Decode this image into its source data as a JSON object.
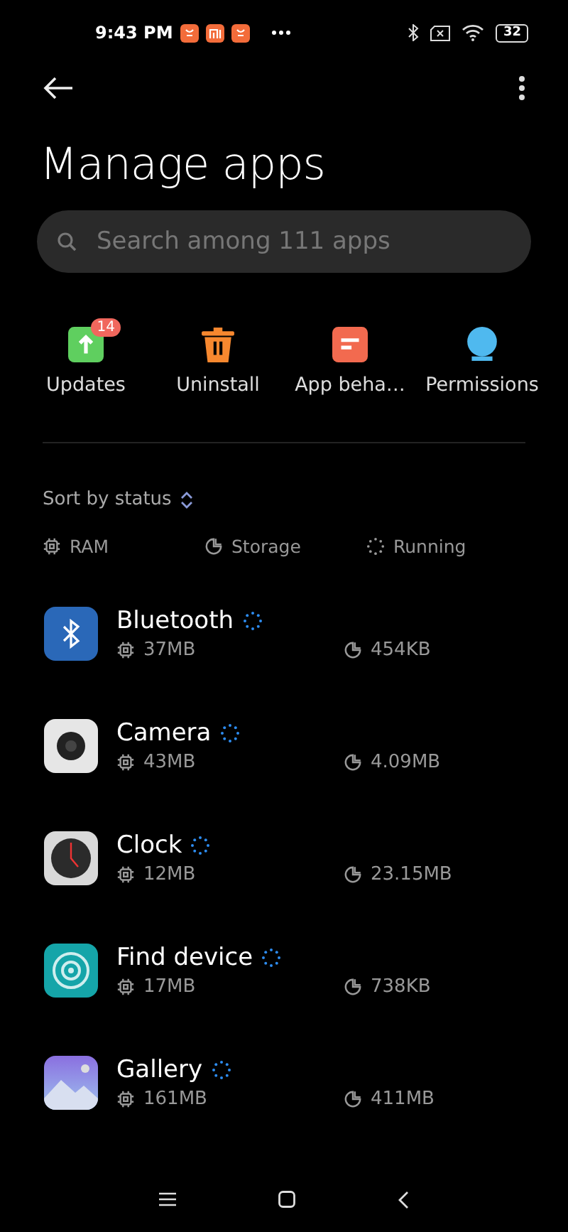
{
  "status_bar": {
    "time": "9:43 PM",
    "notifications": [
      {
        "kind": "bag"
      },
      {
        "kind": "mi"
      },
      {
        "kind": "bag"
      }
    ],
    "battery": "32"
  },
  "title": "Manage apps",
  "search": {
    "placeholder": "Search among 111 apps"
  },
  "actions": [
    {
      "label": "Updates",
      "kind": "updates",
      "badge": "14"
    },
    {
      "label": "Uninstall",
      "kind": "uninstall"
    },
    {
      "label": "App beha…",
      "kind": "behavior"
    },
    {
      "label": "Permissions",
      "kind": "permissions"
    }
  ],
  "sort": {
    "label": "Sort by status"
  },
  "legend": [
    {
      "label": "RAM",
      "kind": "ram"
    },
    {
      "label": "Storage",
      "kind": "storage"
    },
    {
      "label": "Running",
      "kind": "running"
    }
  ],
  "apps": [
    {
      "name": "Bluetooth",
      "kind": "bluetooth",
      "running": true,
      "ram": "37MB",
      "storage": "454KB"
    },
    {
      "name": "Camera",
      "kind": "camera",
      "running": true,
      "ram": "43MB",
      "storage": "4.09MB"
    },
    {
      "name": "Clock",
      "kind": "clock",
      "running": true,
      "ram": "12MB",
      "storage": "23.15MB"
    },
    {
      "name": "Find device",
      "kind": "find",
      "running": true,
      "ram": "17MB",
      "storage": "738KB"
    },
    {
      "name": "Gallery",
      "kind": "gallery",
      "running": true,
      "ram": "161MB",
      "storage": "411MB"
    }
  ]
}
